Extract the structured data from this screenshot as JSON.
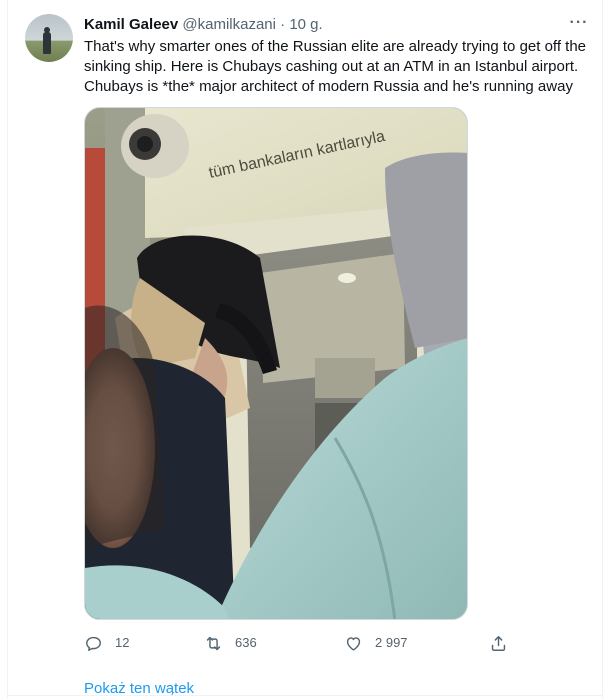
{
  "tweet": {
    "author_name": "Kamil Galeev",
    "author_handle": "@kamilkazani",
    "separator": "·",
    "time": "10 g.",
    "more_icon": "more-dots-icon",
    "text_lines": [
      "That's why smarter ones of the Russian elite are already trying to get off the",
      "sinking ship. Here is Chubays cashing out at an ATM in an Istanbul airport.",
      "Chubays is *the* major architect of modern Russia and he's running away"
    ],
    "image": {
      "atm_sign_text": "tüm bankaların kartlarıyla"
    }
  },
  "actions": {
    "reply": {
      "icon": "reply-icon",
      "count": "12"
    },
    "retweet": {
      "icon": "retweet-icon",
      "count": "636"
    },
    "like": {
      "icon": "heart-icon",
      "count": "2 997"
    },
    "share": {
      "icon": "share-icon"
    }
  },
  "show_thread_label": "Pokaż ten wątek",
  "colors": {
    "accent": "#1d9bf0",
    "muted": "#536471",
    "text": "#0f1419"
  }
}
